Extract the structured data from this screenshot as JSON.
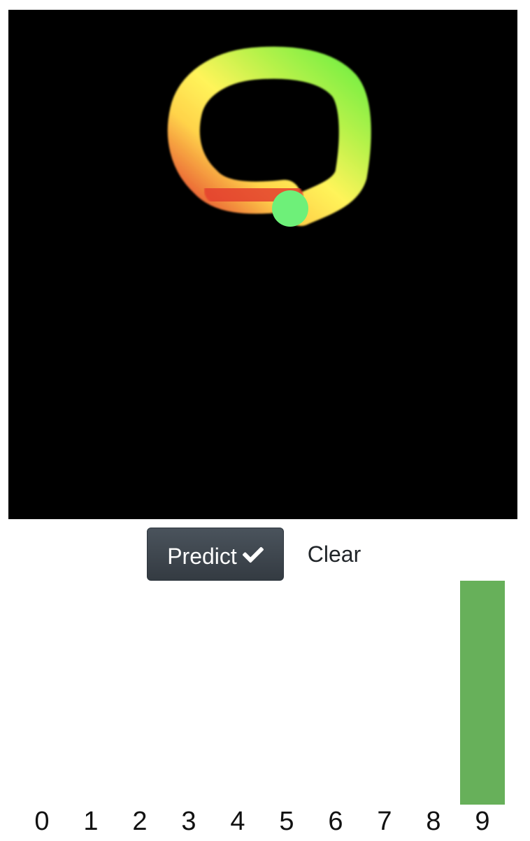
{
  "controls": {
    "predict_label": "Predict",
    "predict_icon": "check-icon",
    "clear_label": "Clear"
  },
  "colors": {
    "canvas_background": "#000000",
    "bar_color": "#67b05a",
    "predict_button_bg": "#3d454d",
    "stroke_gradient": [
      "#e4402e",
      "#ffef5a",
      "#7ff04a",
      "#6ef079"
    ]
  },
  "chart_data": {
    "type": "bar",
    "categories": [
      "0",
      "1",
      "2",
      "3",
      "4",
      "5",
      "6",
      "7",
      "8",
      "9"
    ],
    "values": [
      0,
      0,
      0,
      0,
      0,
      0,
      0,
      0,
      0,
      1
    ],
    "ylim": [
      0,
      1
    ],
    "grid": false
  }
}
